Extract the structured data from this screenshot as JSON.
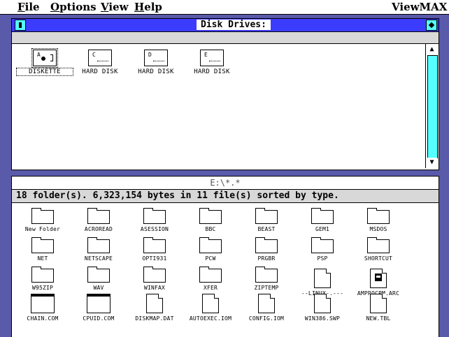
{
  "menubar": {
    "items": [
      {
        "label": "File",
        "u": "F",
        "rest": "ile"
      },
      {
        "label": "Options",
        "u": "O",
        "rest": "ptions"
      },
      {
        "label": "View",
        "u": "V",
        "rest": "iew"
      },
      {
        "label": "Help",
        "u": "H",
        "rest": "elp"
      }
    ],
    "app_name": "ViewMAX"
  },
  "drives_window": {
    "title": "Disk Drives:",
    "drives": [
      {
        "letter": "A",
        "label": "DISKETTE",
        "type": "floppy",
        "selected": true
      },
      {
        "letter": "C",
        "label": "HARD DISK",
        "type": "hard"
      },
      {
        "letter": "D",
        "label": "HARD DISK",
        "type": "hard"
      },
      {
        "letter": "E",
        "label": "HARD DISK",
        "type": "hard"
      }
    ],
    "scroll_up": "▲",
    "scroll_down": "▼"
  },
  "files_window": {
    "title": "E:\\*.*",
    "info": "18 folder(s).  6,323,154 bytes in 11 file(s) sorted by type.",
    "items": [
      {
        "name": "New Folder",
        "kind": "folder"
      },
      {
        "name": "ACROREAD",
        "kind": "folder"
      },
      {
        "name": "ASESSION",
        "kind": "folder"
      },
      {
        "name": "BBC",
        "kind": "folder"
      },
      {
        "name": "BEAST",
        "kind": "folder"
      },
      {
        "name": "GEM1",
        "kind": "folder"
      },
      {
        "name": "MSDOS",
        "kind": "folder"
      },
      {
        "name": "NET",
        "kind": "folder"
      },
      {
        "name": "NETSCAPE",
        "kind": "folder"
      },
      {
        "name": "OPTI931",
        "kind": "folder"
      },
      {
        "name": "PCW",
        "kind": "folder"
      },
      {
        "name": "PRGBR",
        "kind": "folder"
      },
      {
        "name": "PSP",
        "kind": "folder"
      },
      {
        "name": "SHORTCUT",
        "kind": "folder"
      },
      {
        "name": "W95ZIP",
        "kind": "folder"
      },
      {
        "name": "WAV",
        "kind": "folder"
      },
      {
        "name": "WINFAX",
        "kind": "folder"
      },
      {
        "name": "XFER",
        "kind": "folder"
      },
      {
        "name": "ZIPTEMP",
        "kind": "folder"
      },
      {
        "name": "--LINUX-.---",
        "kind": "doc"
      },
      {
        "name": "AMPROCPM.ARC",
        "kind": "arc"
      },
      {
        "name": "CHAIN.COM",
        "kind": "exe"
      },
      {
        "name": "CPUID.COM",
        "kind": "exe"
      },
      {
        "name": "DISKMAP.DAT",
        "kind": "doc"
      },
      {
        "name": "AUTOEXEC.IOM",
        "kind": "doc"
      },
      {
        "name": "CONFIG.IOM",
        "kind": "doc"
      },
      {
        "name": "WIN386.SWP",
        "kind": "doc"
      },
      {
        "name": "NEW.TBL",
        "kind": "doc"
      }
    ]
  }
}
